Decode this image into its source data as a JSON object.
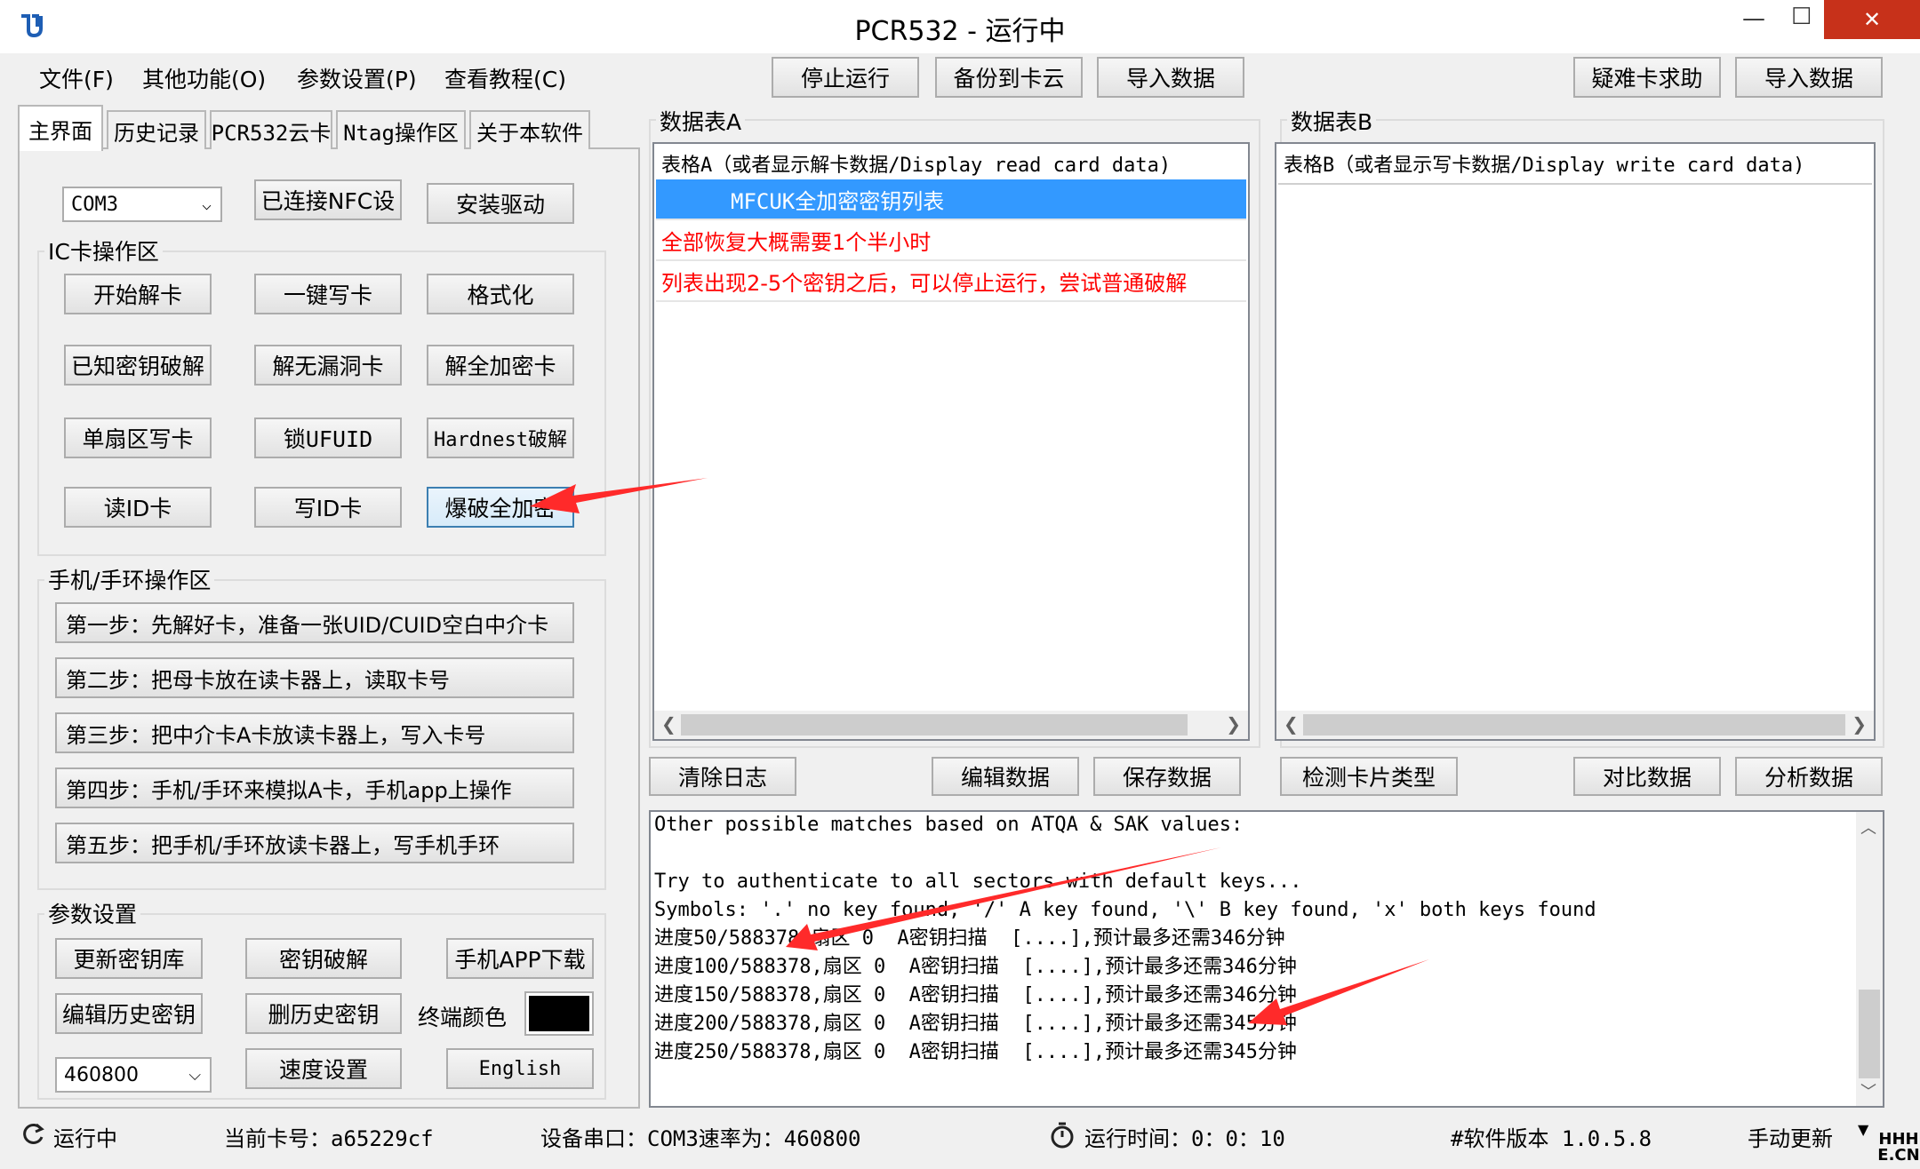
{
  "window": {
    "title": "PCR532 - 运行中",
    "minimize": "—",
    "maximize": "☐",
    "close": "✕"
  },
  "menu": [
    "文件(F)",
    "其他功能(O)",
    "参数设置(P)",
    "查看教程(C)"
  ],
  "toolbar": {
    "stop": "停止运行",
    "backup": "备份到卡云",
    "import": "导入数据",
    "help": "疑难卡求助",
    "import2": "导入数据"
  },
  "tabs": [
    "主界面",
    "历史记录",
    "PCR532云卡",
    "Ntag操作区",
    "关于本软件"
  ],
  "top_controls": {
    "port": "COM3",
    "connected": "已连接NFC设",
    "driver": "安装驱动"
  },
  "ic_group": {
    "label": "IC卡操作区",
    "buttons": [
      "开始解卡",
      "一键写卡",
      "格式化",
      "已知密钥破解",
      "解无漏洞卡",
      "解全加密卡",
      "单扇区写卡",
      "锁UFUID",
      "Hardnest破解",
      "读ID卡",
      "写ID卡",
      "爆破全加密"
    ]
  },
  "phone_group": {
    "label": "手机/手环操作区",
    "steps": [
      "第一步：先解好卡，准备一张UID/CUID空白中介卡",
      "第二步：把母卡放在读卡器上，读取卡号",
      "第三步：把中介卡A卡放读卡器上，写入卡号",
      "第四步：手机/手环来模拟A卡，手机app上操作",
      "第五步：把手机/手环放读卡器上，写手机手环"
    ]
  },
  "param_group": {
    "label": "参数设置",
    "buttons": [
      "更新密钥库",
      "密钥破解",
      "手机APP下载",
      "编辑历史密钥",
      "删历史密钥"
    ],
    "terminal_color_label": "终端颜色",
    "baud": "460800",
    "speed": "速度设置",
    "english": "English"
  },
  "tableA": {
    "label": "数据表A",
    "header": "表格A（或者显示解卡数据/Display read card data)",
    "rows": [
      "MFCUK全加密密钥列表",
      "全部恢复大概需要1个半小时",
      "列表出现2-5个密钥之后，可以停止运行，尝试普通破解"
    ]
  },
  "tableB": {
    "label": "数据表B",
    "header": "表格B（或者显示写卡数据/Display write card data)"
  },
  "bottom_buttons": {
    "clear": "清除日志",
    "edit": "编辑数据",
    "save": "保存数据",
    "detect": "检测卡片类型",
    "compare": "对比数据",
    "analyze": "分析数据"
  },
  "log": [
    "Other possible matches based on ATQA & SAK values:",
    "",
    "Try to authenticate to all sectors with default keys...",
    "Symbols: '.' no key found, '/' A key found, '\\' B key found, 'x' both keys found",
    "进度50/588378,扇区 0  A密钥扫描  [....],预计最多还需346分钟",
    "进度100/588378,扇区 0  A密钥扫描  [....],预计最多还需346分钟",
    "进度150/588378,扇区 0  A密钥扫描  [....],预计最多还需346分钟",
    "进度200/588378,扇区 0  A密钥扫描  [....],预计最多还需345分钟",
    "进度250/588378,扇区 0  A密钥扫描  [....],预计最多还需345分钟"
  ],
  "status": {
    "running": "运行中",
    "card": "当前卡号：a65229cf",
    "port": "设备串口：COM3速率为：460800",
    "time": "运行时间：0：0：10",
    "version": "#软件版本 1.0.5.8",
    "update": "手动更新"
  },
  "watermark": "HHH\nE.CN",
  "colors": {
    "selected_row": "#3399ff",
    "red_text": "#ff0000",
    "terminal_color": "#000000",
    "annotation_arrow": "#ff2a2a"
  }
}
